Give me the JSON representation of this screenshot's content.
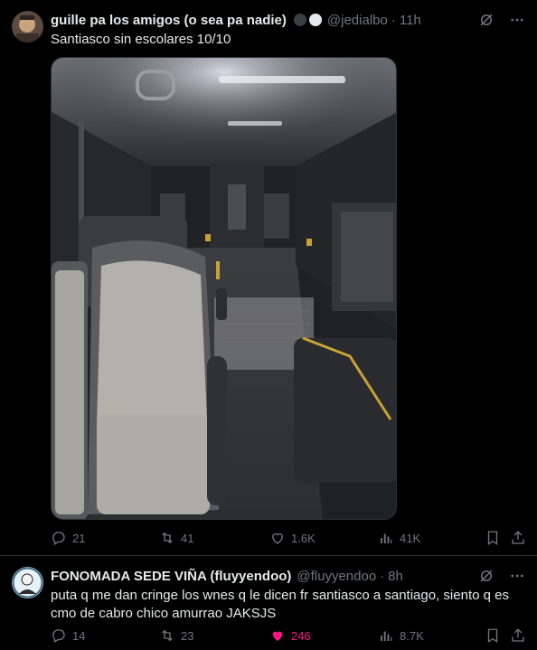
{
  "posts": [
    {
      "display_name": "guille pa los amigos (o sea pa nadie)",
      "handle": "@jedialbo",
      "separator": "·",
      "time": "11h",
      "text": "Santiasco sin escolares 10/10",
      "stats": {
        "replies": "21",
        "reposts": "41",
        "likes": "1.6K",
        "views": "41K"
      }
    },
    {
      "display_name": "FONOMADA SEDE VIÑA (fluyyendoo)",
      "handle": "@fluyyendoo",
      "separator": "·",
      "time": "8h",
      "text": "puta q me dan cringe los wnes q le dicen fr santiasco a santiago, siento q es cmo de cabro chico amurrao JAKSJS",
      "stats": {
        "replies": "14",
        "reposts": "23",
        "likes": "246",
        "views": "8.7K"
      }
    }
  ],
  "colors": {
    "background": "#000000",
    "text": "#e7e9ea",
    "muted": "#71767b",
    "like_active": "#f91880",
    "divider": "#2f3336"
  },
  "icons": [
    "grok-icon",
    "more-icon",
    "reply-icon",
    "repost-icon",
    "like-icon",
    "views-icon",
    "bookmark-icon",
    "share-icon"
  ]
}
